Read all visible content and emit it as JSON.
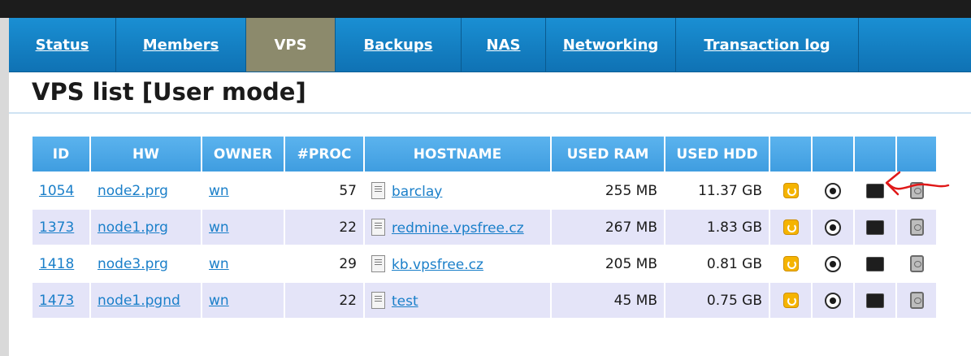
{
  "nav": {
    "tabs": [
      {
        "label": "Status",
        "active": false
      },
      {
        "label": "Members",
        "active": false
      },
      {
        "label": "VPS",
        "active": true
      },
      {
        "label": "Backups",
        "active": false
      },
      {
        "label": "NAS",
        "active": false
      },
      {
        "label": "Networking",
        "active": false
      },
      {
        "label": "Transaction log",
        "active": false
      }
    ]
  },
  "page": {
    "title": "VPS list [User mode]"
  },
  "table": {
    "headers": [
      "ID",
      "HW",
      "OWNER",
      "#PROC",
      "HOSTNAME",
      "USED RAM",
      "USED HDD"
    ],
    "rows": [
      {
        "id": "1054",
        "hw": "node2.prg",
        "owner": "wn",
        "proc": "57",
        "hostname": "barclay",
        "ram": "255 MB",
        "hdd": "11.37 GB"
      },
      {
        "id": "1373",
        "hw": "node1.prg",
        "owner": "wn",
        "proc": "22",
        "hostname": "redmine.vpsfree.cz",
        "ram": "267 MB",
        "hdd": "1.83 GB"
      },
      {
        "id": "1418",
        "hw": "node3.prg",
        "owner": "wn",
        "proc": "29",
        "hostname": "kb.vpsfree.cz",
        "ram": "205 MB",
        "hdd": "0.81 GB"
      },
      {
        "id": "1473",
        "hw": "node1.pgnd",
        "owner": "wn",
        "proc": "22",
        "hostname": "test",
        "ram": "45 MB",
        "hdd": "0.75 GB"
      }
    ],
    "row_icons": [
      "restart-icon",
      "stop-icon",
      "console-icon",
      "trash-icon"
    ]
  },
  "colors": {
    "nav_bg": "#1580c6",
    "nav_active": "#8c8a6c",
    "header_bg": "#4aa7e8",
    "row_alt": "#e4e4f8",
    "link": "#1a7fc9",
    "annotation": "#e01818"
  }
}
